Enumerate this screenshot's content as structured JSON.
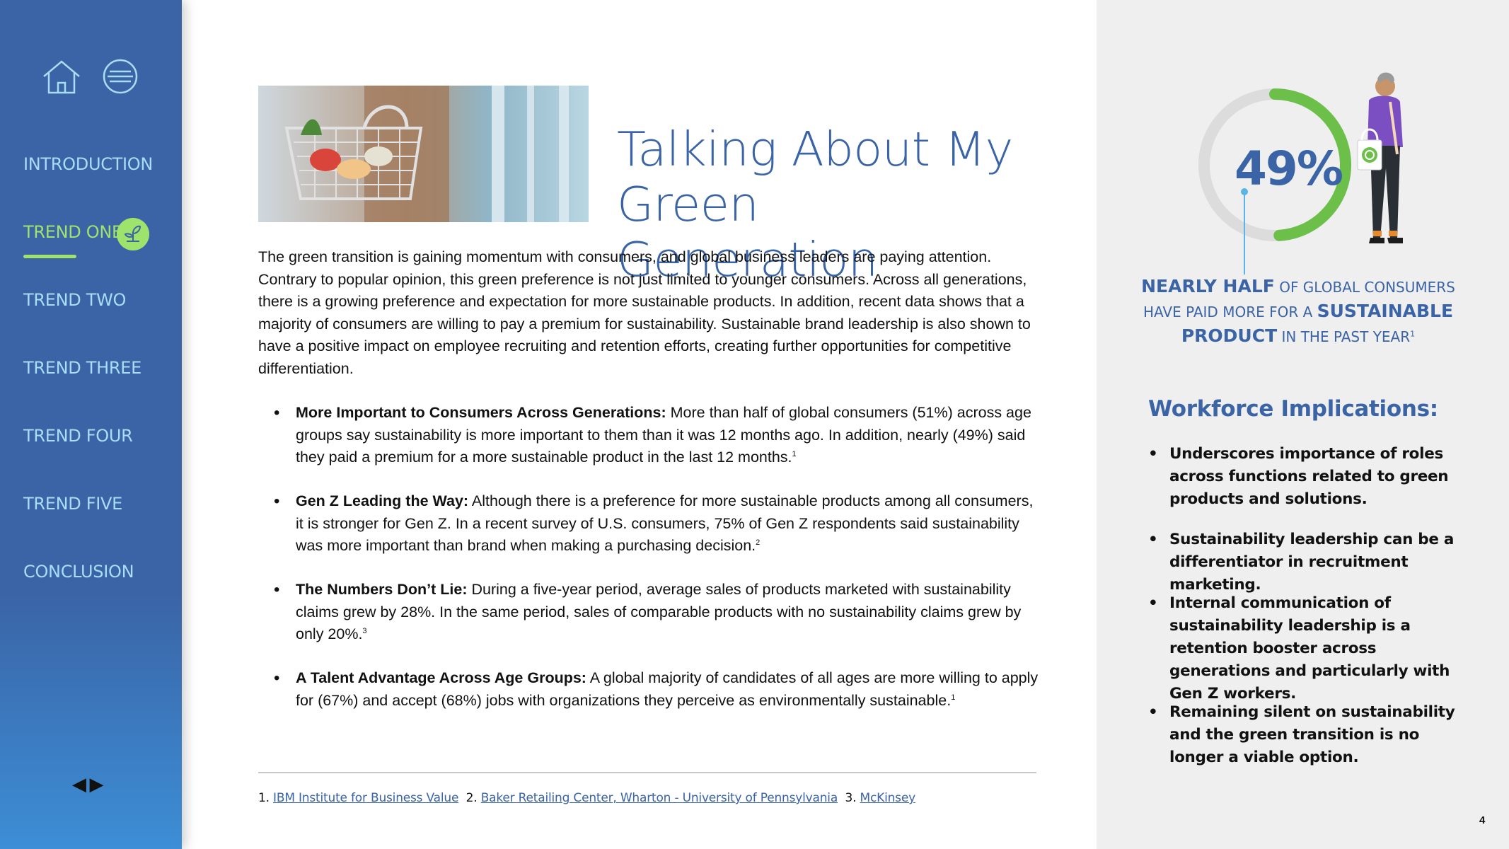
{
  "sidebar": {
    "nav": [
      {
        "label": "INTRODUCTION",
        "active": false
      },
      {
        "label": "TREND ONE",
        "active": true
      },
      {
        "label": "TREND TWO",
        "active": false
      },
      {
        "label": "TREND THREE",
        "active": false
      },
      {
        "label": "TREND FOUR",
        "active": false
      },
      {
        "label": "TREND FIVE",
        "active": false
      },
      {
        "label": "CONCLUSION",
        "active": false
      }
    ],
    "icons": {
      "home": "home-icon",
      "menu": "menu-icon",
      "trend_badge": "plant-icon",
      "prev": "triangle-left-icon",
      "next": "triangle-right-icon"
    },
    "prev_glyph": "◀",
    "next_glyph": "▶"
  },
  "main": {
    "title_line1": "Talking About My",
    "title_line2": "Green Generation",
    "intro": "The green transition is gaining momentum with consumers, and global business leaders are paying attention. Contrary to popular opinion, this green preference is not just limited to younger consumers. Across all generations, there is a growing preference and expectation for more sustainable products. In addition, recent data shows that a majority of consumers are willing to pay a premium for sustainability. Sustainable brand leadership is also shown to have a positive impact on employee recruiting and retention efforts, creating further opportunities for competitive differentiation.",
    "bullets": [
      {
        "bold": "More Important to Consumers Across Generations:",
        "text": " More than half of global consumers (51%) across age groups say sustainability is more important to them than it was 12 months ago. In addition, nearly (49%) said they paid a premium for a more sustainable product in the last 12 months.",
        "sup": "1"
      },
      {
        "bold": "Gen Z Leading the Way:",
        "text": " Although there is a preference for more sustainable products among all consumers, it is stronger for Gen Z. In a recent survey of U.S. consumers, 75% of Gen Z respondents said sustainability was more important than brand when making a purchasing decision.",
        "sup": "2"
      },
      {
        "bold": "The Numbers Don’t Lie:",
        "text": " During a five-year period, average sales of products marketed with sustainability claims grew by 28%. In the same period, sales of comparable products with no sustainability claims grew by only 20%.",
        "sup": "3"
      },
      {
        "bold": "A Talent Advantage Across Age Groups:",
        "text": " A global majority of candidates of all ages are more willing to apply for (67%) and accept (68%) jobs with organizations they perceive as environmentally sustainable.",
        "sup": "1"
      }
    ],
    "footnotes": [
      {
        "num": "1.",
        "label": "IBM Institute for Business Value"
      },
      {
        "num": "2.",
        "label": "Baker Retailing Center, Wharton - University of Pennsylvania"
      },
      {
        "num": "3.",
        "label": "McKinsey"
      }
    ]
  },
  "stat": {
    "percent": "49%",
    "fraction": 0.49,
    "line1_bold": "NEARLY HALF",
    "line1_rest": " OF GLOBAL CONSUMERS",
    "line2_rest": "HAVE PAID MORE FOR A ",
    "line2_bold": "SUSTAINABLE",
    "line3_bold": "PRODUCT",
    "line3_rest": " IN THE PAST YEAR",
    "sup": "1",
    "colors": {
      "arc": "#6cc04a",
      "track": "#dcdcdc",
      "text": "#3a64a6"
    }
  },
  "workforce": {
    "heading": "Workforce Implications:",
    "items": [
      "Underscores importance of roles across functions related to green products and solutions.",
      "Sustainability leadership can be a differentiator in recruitment marketing.",
      "Internal communication of sustainability leadership is a retention booster across generations and particularly with Gen Z workers.",
      "Remaining silent on sustainability and the green transition is no longer a viable option."
    ]
  },
  "page_number": "4",
  "colors": {
    "sidebar": "#3a64a6",
    "accent_green": "#9ee46c",
    "nav_text": "#a9dcf6",
    "title_blue": "#3a64a6",
    "panel_bg": "#efefef"
  }
}
